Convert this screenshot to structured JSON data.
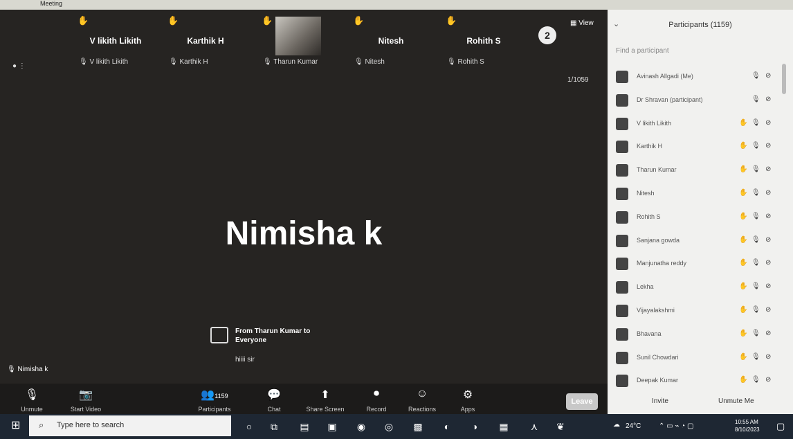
{
  "window": {
    "title": "Meeting"
  },
  "tiles": [
    {
      "big": "V likith Likith",
      "small": "V likith Likith"
    },
    {
      "big": "Karthik H",
      "small": "Karthik H"
    },
    {
      "big": "",
      "small": "Tharun Kumar"
    },
    {
      "big": "Nitesh",
      "small": "Nitesh"
    },
    {
      "big": "Rohith S",
      "small": "Rohith S"
    }
  ],
  "gallery": {
    "view_label": "View",
    "page": "1/1059",
    "nav_number": "2"
  },
  "speaker": {
    "name": "Nimisha k"
  },
  "chat_toast": {
    "from": "From Tharun Kumar to Everyone",
    "message": "hiiii sir"
  },
  "self_label": "Nimisha k",
  "toolbar": {
    "unmute": "Unmute",
    "start_video": "Start Video",
    "participants": "Participants",
    "participants_count": "1159",
    "chat": "Chat",
    "share_screen": "Share Screen",
    "record": "Record",
    "reactions": "Reactions",
    "apps": "Apps",
    "leave": "Leave"
  },
  "panel": {
    "title": "Participants (1159)",
    "search_placeholder": "Find a participant",
    "participants": [
      {
        "name": "Avinash Allgadi (Me)"
      },
      {
        "name": "Dr Shravan (participant)"
      },
      {
        "name": "V likith Likith"
      },
      {
        "name": "Karthik H"
      },
      {
        "name": "Tharun Kumar"
      },
      {
        "name": "Nitesh"
      },
      {
        "name": "Rohith S"
      },
      {
        "name": "Sanjana gowda"
      },
      {
        "name": "Manjunatha reddy"
      },
      {
        "name": "Lekha"
      },
      {
        "name": "Vijayalakshmi"
      },
      {
        "name": "Bhavana"
      },
      {
        "name": "Sunil Chowdari"
      },
      {
        "name": "Deepak Kumar"
      }
    ],
    "invite": "Invite",
    "unmute_me": "Unmute Me"
  },
  "taskbar": {
    "search_placeholder": "Type here to search",
    "temperature": "24°C",
    "time": "10:55 AM",
    "date": "8/10/2023"
  }
}
